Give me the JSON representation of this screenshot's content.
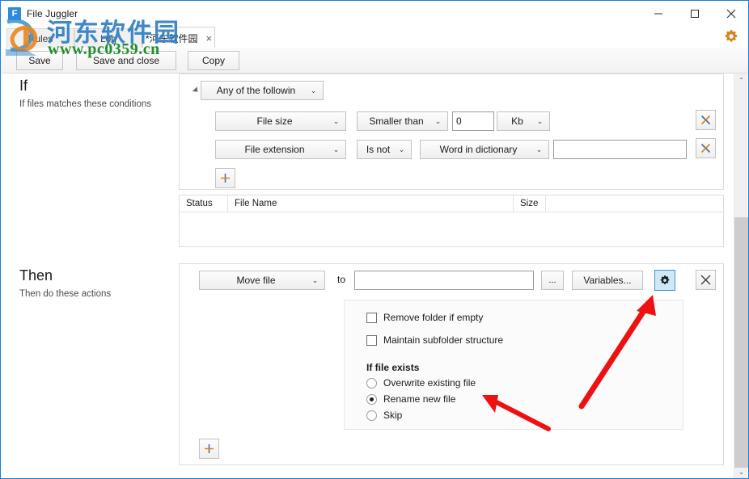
{
  "window": {
    "title": "File Juggler",
    "app_icon_letter": "F",
    "minimize_label": "Minimize",
    "maximize_label": "Maximize",
    "close_label": "Close",
    "settings_label": "Settings"
  },
  "tabs": [
    {
      "label": "Rules",
      "active": false,
      "closable": false
    },
    {
      "label": "Log",
      "active": false,
      "closable": false
    },
    {
      "label": "*河东软件园",
      "active": true,
      "closable": true,
      "close_glyph": "×"
    }
  ],
  "toolbar": {
    "save_label": "Save",
    "save_close_label": "Save and close",
    "copy_label": "Copy"
  },
  "if_section": {
    "title": "If",
    "subtitle": "If files matches these conditions",
    "match_mode": "Any of the followin",
    "add_condition_label": "+",
    "conditions": [
      {
        "field": "File size",
        "operator": "Smaller than",
        "value": "0",
        "unit": "Kb",
        "delete_label": "X"
      },
      {
        "field": "File extension",
        "operator": "Is not",
        "source": "Word in dictionary",
        "value": "",
        "delete_label": "X"
      }
    ]
  },
  "file_table": {
    "columns": [
      "Status",
      "File Name",
      "Size"
    ],
    "rows": []
  },
  "then_section": {
    "title": "Then",
    "subtitle": "Then do these actions",
    "action": "Move file",
    "to_label": "to",
    "destination_value": "",
    "browse_label": "...",
    "variables_label": "Variables...",
    "settings_label": "Settings",
    "delete_label": "X",
    "add_action_label": "+",
    "checkboxes": [
      {
        "label": "Remove folder if empty",
        "checked": false
      },
      {
        "label": "Maintain subfolder structure",
        "checked": false
      }
    ],
    "if_file_exists_label": "If file exists",
    "if_file_exists_options": [
      {
        "label": "Overwrite existing file",
        "selected": false
      },
      {
        "label": "Rename new file",
        "selected": true
      },
      {
        "label": "Skip",
        "selected": false
      }
    ]
  },
  "watermark": {
    "site_cn": "河东软件园",
    "site_url": "www.pc0359.cn"
  },
  "colors": {
    "window_border": "#1a7fd4",
    "accent_pressed": "#cde8f7",
    "accent_border": "#3c9ad4",
    "gear_orange": "#d8821e",
    "annotation_red": "#ee1111",
    "watermark_blue": "#2f7fc4",
    "watermark_green": "#1f8f2f"
  },
  "scrollbar": {
    "up_glyph": "⌃",
    "down_glyph": "⌄",
    "thumb_top_pct": 35,
    "thumb_height_pct": 62
  }
}
